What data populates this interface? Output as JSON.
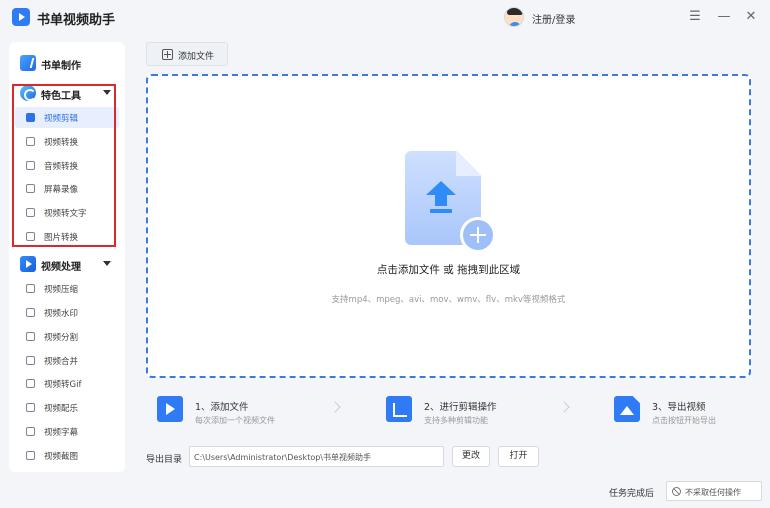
{
  "app": {
    "title": "书单视频助手"
  },
  "header": {
    "login_label": "注册/登录"
  },
  "window_controls": {
    "menu": "☰",
    "minimize": "—",
    "close": "✕"
  },
  "sidebar": {
    "book_section": {
      "label": "书单制作",
      "icon": "book-icon"
    },
    "feature_section": {
      "label": "特色工具",
      "icon": "feature-tools-icon",
      "items": [
        {
          "label": "视频剪辑",
          "icon": "crop-icon",
          "active": true
        },
        {
          "label": "视频转换",
          "icon": "video-convert-icon"
        },
        {
          "label": "音频转换",
          "icon": "audio-convert-icon"
        },
        {
          "label": "屏幕录像",
          "icon": "screen-record-icon"
        },
        {
          "label": "视频转文字",
          "icon": "text-icon"
        },
        {
          "label": "图片转换",
          "icon": "image-icon"
        }
      ]
    },
    "video_section": {
      "label": "视频处理",
      "icon": "video-process-icon",
      "items": [
        {
          "label": "视频压缩",
          "icon": "compress-icon"
        },
        {
          "label": "视频水印",
          "icon": "watermark-icon"
        },
        {
          "label": "视频分割",
          "icon": "split-icon"
        },
        {
          "label": "视频合并",
          "icon": "merge-icon"
        },
        {
          "label": "视频转Gif",
          "icon": "gif-icon"
        },
        {
          "label": "视频配乐",
          "icon": "music-icon"
        },
        {
          "label": "视频字幕",
          "icon": "subtitle-icon"
        },
        {
          "label": "视频截图",
          "icon": "screenshot-icon"
        }
      ]
    }
  },
  "toolbar": {
    "add_file_label": "添加文件"
  },
  "dropzone": {
    "main_text": "点击添加文件 或 拖拽到此区域",
    "sub_text": "支持mp4、mpeg、avi、mov、wmv、flv、mkv等视频格式"
  },
  "steps": [
    {
      "title": "1、添加文件",
      "desc": "每次添加一个视频文件"
    },
    {
      "title": "2、进行剪辑操作",
      "desc": "支持多种剪辑功能"
    },
    {
      "title": "3、导出视频",
      "desc": "点击按钮开始导出"
    }
  ],
  "output": {
    "label": "导出目录",
    "path": "C:\\Users\\Administrator\\Desktop\\书单视频助手",
    "change_label": "更改",
    "open_label": "打开"
  },
  "status": {
    "label": "任务完成后",
    "select_value": "不采取任何操作"
  },
  "colors": {
    "accent": "#2f7bf5",
    "highlight_border": "#d9292b"
  }
}
